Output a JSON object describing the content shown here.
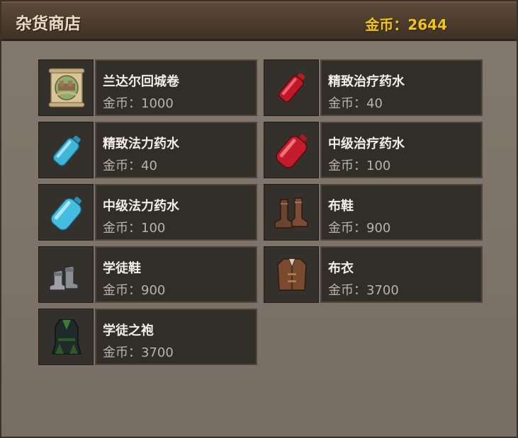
{
  "shop": {
    "title": "杂货商店",
    "gold_label": "金币：",
    "gold_amount": "2644"
  },
  "price_label": "金币：",
  "items": [
    {
      "name": "兰达尔回城卷",
      "price": "1000",
      "icon": "scroll-icon"
    },
    {
      "name": "精致治疗药水",
      "price": "40",
      "icon": "red-potion-small-icon"
    },
    {
      "name": "精致法力药水",
      "price": "40",
      "icon": "blue-potion-small-icon"
    },
    {
      "name": "中级治疗药水",
      "price": "100",
      "icon": "red-potion-medium-icon"
    },
    {
      "name": "中级法力药水",
      "price": "100",
      "icon": "blue-potion-medium-icon"
    },
    {
      "name": "布鞋",
      "price": "900",
      "icon": "cloth-boots-icon"
    },
    {
      "name": "学徒鞋",
      "price": "900",
      "icon": "apprentice-boots-icon"
    },
    {
      "name": "布衣",
      "price": "3700",
      "icon": "cloth-vest-icon"
    },
    {
      "name": "学徒之袍",
      "price": "3700",
      "icon": "apprentice-robe-icon"
    }
  ]
}
